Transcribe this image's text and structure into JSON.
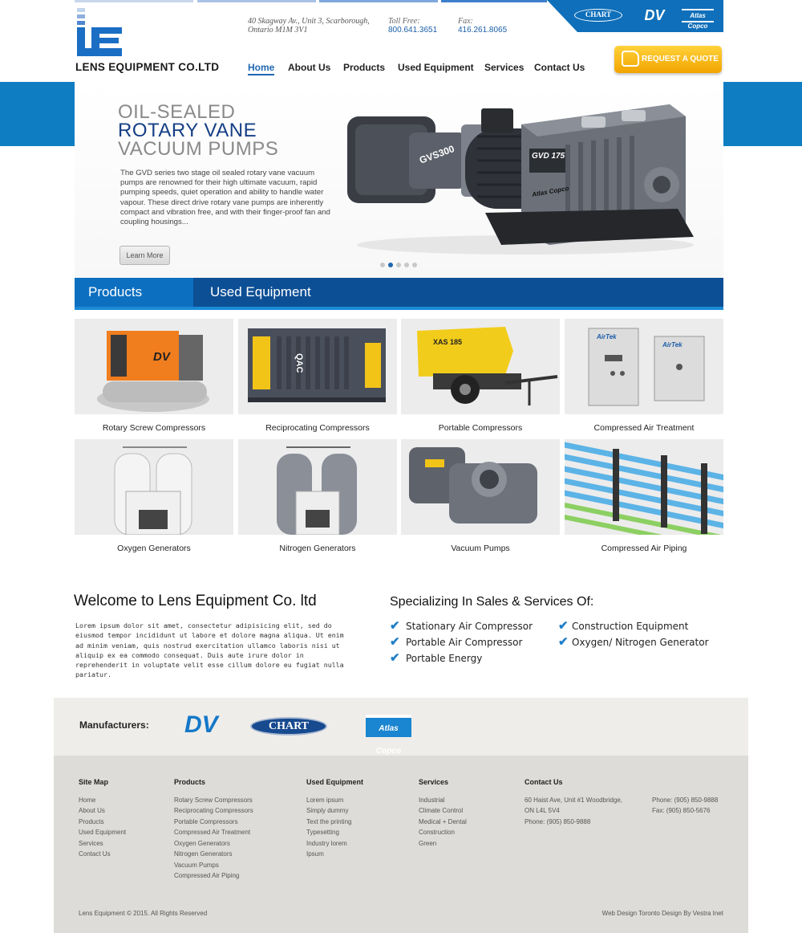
{
  "header": {
    "company_name": "LENS EQUIPMENT CO.LTD",
    "address": "40 Skagway Av., Unit 3, Scarborough, Ontario M1M 3V1",
    "toll_free_label": "Toll Free:",
    "toll_free": "800.641.3651",
    "fax_label": "Fax:",
    "fax": "416.261.8065",
    "brands": [
      "CHART",
      "DV",
      "Atlas Copco"
    ],
    "quote_button": "REQUEST A QUOTE"
  },
  "nav": {
    "items": [
      "Home",
      "About Us",
      "Products",
      "Used Equipment",
      "Services",
      "Contact Us"
    ],
    "active": "Home"
  },
  "hero": {
    "title_line1": "OIL-SEALED",
    "title_line2": "ROTARY VANE",
    "title_line3": "VACUUM PUMPS",
    "description": "The GVD series two stage oil sealed rotary vane vacuum pumps are renowned for their high ultimate vacuum, rapid pumping speeds, quiet operation and ability to handle water vapour. These direct drive rotary vane pumps are inherently compact and vibration free, and with their finger-proof fan and coupling housings...",
    "button": "Learn More",
    "image_labels": [
      "GVS300",
      "GVD 175",
      "Atlas Copco"
    ],
    "slides": 5,
    "active_slide": 2
  },
  "tabs": [
    "Products",
    "Used Equipment"
  ],
  "products": [
    "Rotary Screw Compressors",
    "Reciprocating Compressors",
    "Portable Compressors",
    "Compressed Air Treatment",
    "Oxygen Generators",
    "Nitrogen Generators",
    "Vacuum Pumps",
    "Compressed Air Piping"
  ],
  "product_image_labels": {
    "dv": "DV",
    "qac": "QAC",
    "xas": "XAS 185",
    "airtek": "AirTek"
  },
  "welcome": {
    "title": "Welcome to Lens Equipment Co. ltd",
    "text": "Lorem ipsum dolor sit amet, consectetur adipisicing elit, sed do eiusmod tempor incididunt ut labore et dolore magna aliqua. Ut enim ad minim veniam, quis nostrud exercitation ullamco laboris nisi ut aliquip ex ea commodo consequat. Duis aute irure dolor in reprehenderit in voluptate velit esse cillum dolore eu fugiat nulla pariatur."
  },
  "specializing": {
    "title": "Specializing In Sales & Services Of:",
    "items": [
      "Stationary Air Compressor",
      "Construction Equipment",
      "Portable Air Compressor",
      "Oxygen/ Nitrogen Generator",
      "Portable Energy"
    ]
  },
  "manufacturers": {
    "label": "Manufacturers:",
    "logos": [
      "DV",
      "CHART",
      "Atlas Copco"
    ]
  },
  "footer": {
    "sitemap": {
      "title": "Site Map",
      "links": [
        "Home",
        "About Us",
        "Products",
        "Used Equipment",
        "Services",
        "Contact Us"
      ]
    },
    "products": {
      "title": "Products",
      "links": [
        "Rotary Screw Compressors",
        "Reciprocating Compressors",
        "Portable Compressors",
        "Compressed Air Treatment",
        "Oxygen Generators",
        "Nitrogen Generators",
        "Vacuum Pumps",
        "Compressed Air Piping"
      ]
    },
    "used": {
      "title": "Used Equipment",
      "links": [
        "Lorem ipsum",
        "Simply dummy",
        "Text the printing",
        "Typesetting",
        "Industry lorem",
        "Ipsum"
      ]
    },
    "services": {
      "title": "Services",
      "links": [
        "Industrial",
        "Climate Control",
        "Medical + Dental",
        "Construction",
        "Green"
      ]
    },
    "contact": {
      "title": "Contact Us",
      "address1": "60 Haist Ave, Unit #1 Woodbridge,",
      "address2": "ON L4L 5V4",
      "phone": "Phone: (905) 850-9888",
      "phone2": "Phone: (905) 850-9888",
      "fax": "Fax: (905) 850-5676"
    },
    "copyright": "Lens Equipment © 2015. All Rights Reserved",
    "credit": "Web Design Toronto Design By Vestra Inet"
  },
  "colors": {
    "primary_blue": "#0f6fba",
    "dark_blue": "#0d4f95",
    "accent_yellow": "#f2a400",
    "check_blue": "#1f7fc8"
  }
}
